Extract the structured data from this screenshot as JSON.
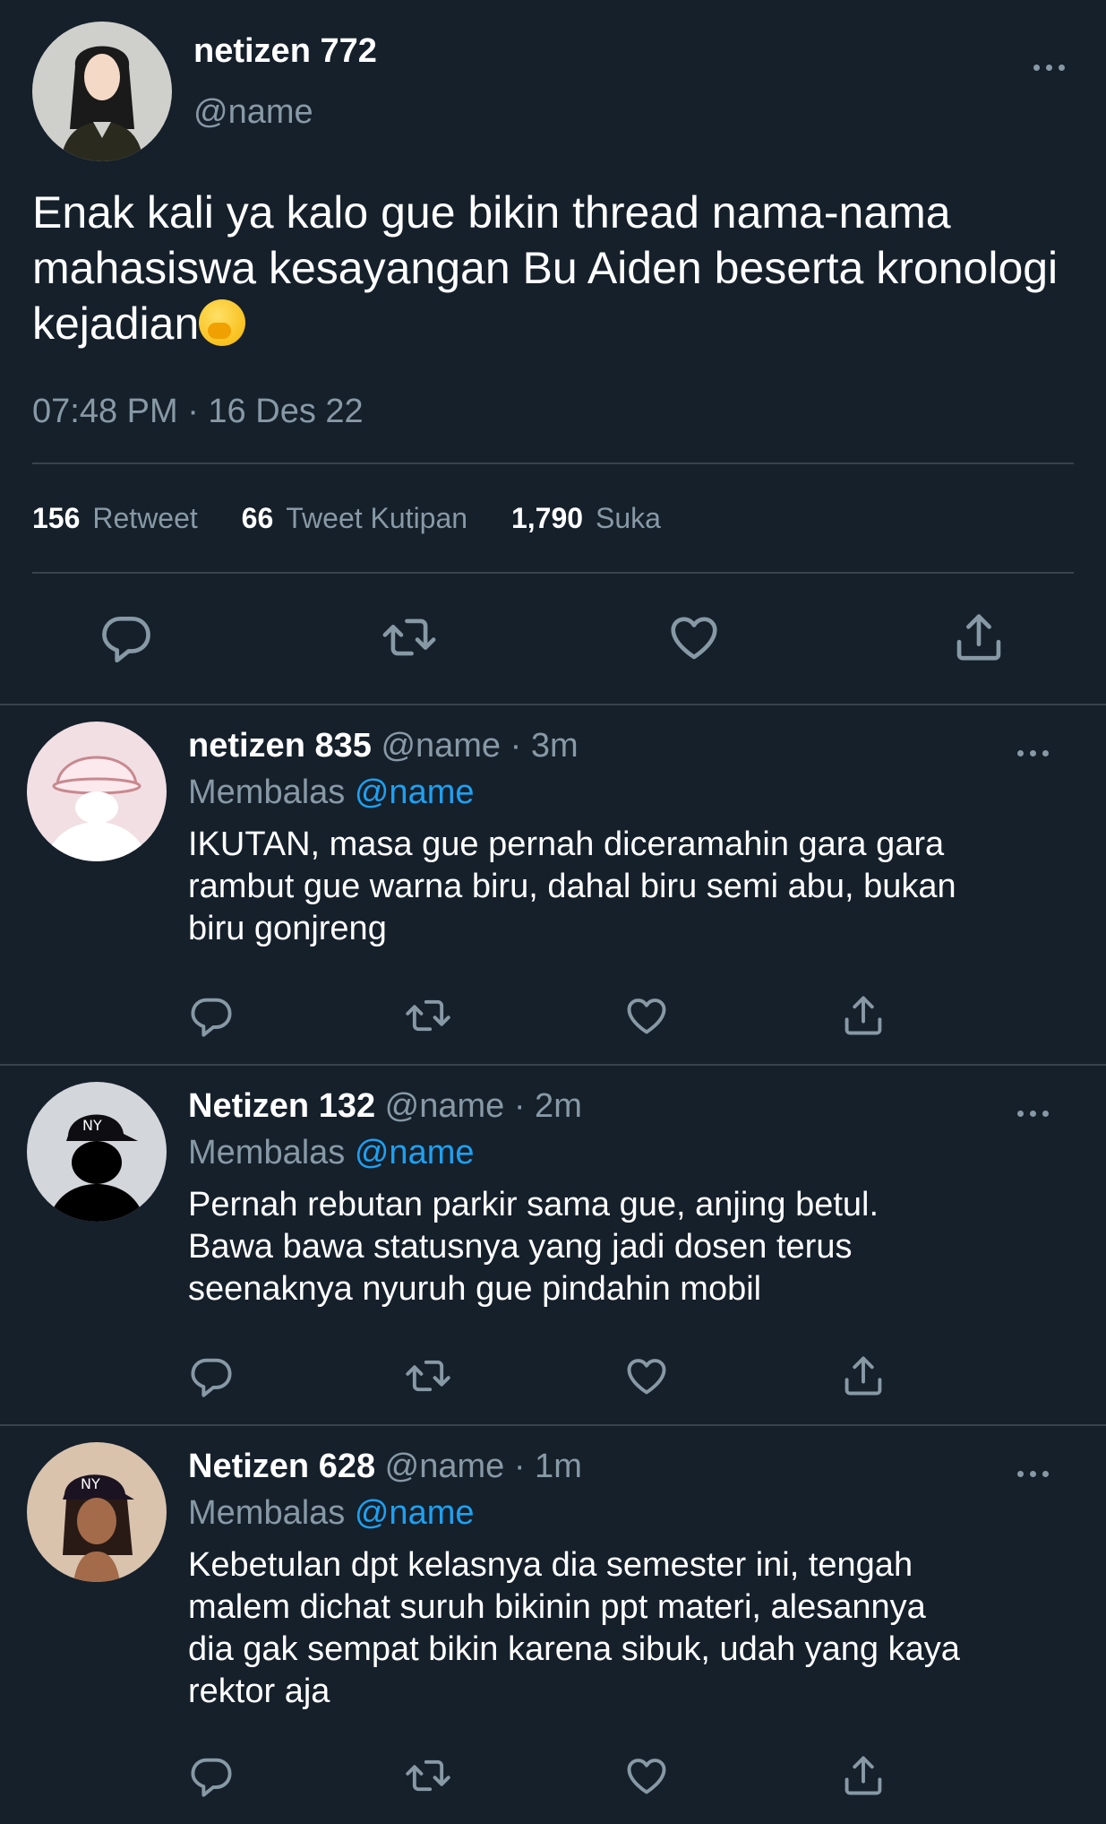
{
  "main_tweet": {
    "display_name": "netizen 772",
    "handle": "@name",
    "text": "Enak kali ya kalo gue bikin thread nama-nama mahasiswa kesayangan Bu Aiden beserta kronologi kejadian",
    "emoji": "face-with-hand-over-mouth",
    "timestamp": "07:48 PM · 16 Des 22",
    "stats": {
      "retweets": "156",
      "retweets_label": "Retweet",
      "quotes": "66",
      "quotes_label": "Tweet Kutipan",
      "likes": "1,790",
      "likes_label": "Suka"
    }
  },
  "replies": [
    {
      "display_name": "netizen 835",
      "meta": "@name · 3m",
      "replying_label": "Membalas",
      "replying_to": "@name",
      "text": "IKUTAN, masa gue pernah diceramahin gara gara\nrambut gue warna biru, dahal biru semi abu, bukan\nbiru gonjreng"
    },
    {
      "display_name": "Netizen 132",
      "meta": "@name · 2m",
      "replying_label": "Membalas",
      "replying_to": "@name",
      "text": "Pernah rebutan parkir sama gue, anjing betul.\nBawa bawa statusnya yang jadi dosen terus\nseenaknya nyuruh gue pindahin mobil"
    },
    {
      "display_name": "Netizen 628",
      "meta": "@name · 1m",
      "replying_label": "Membalas",
      "replying_to": "@name",
      "text": "Kebetulan dpt kelasnya dia semester ini, tengah\nmalem dichat suruh bikinin ppt materi, alesannya\ndia gak sempat bikin karena sibuk, udah yang kaya\nrektor aja"
    }
  ],
  "colors": {
    "background": "#15202b",
    "text": "#ffffff",
    "muted": "#8899a6",
    "link": "#1da1f2",
    "divider": "#38444d"
  }
}
